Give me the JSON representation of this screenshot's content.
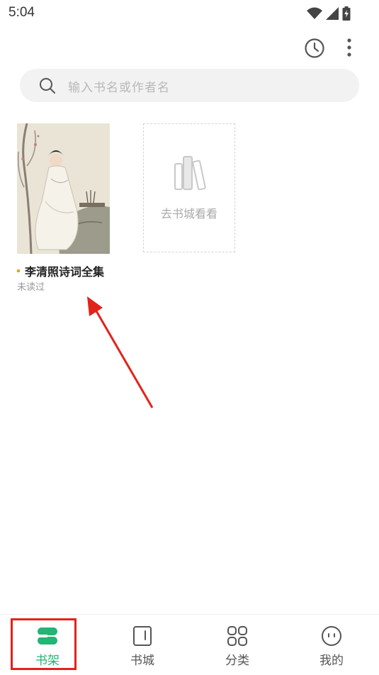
{
  "status_bar": {
    "time": "5:04"
  },
  "header": {
    "history_icon": "clock-icon",
    "more_icon": "more-vertical-icon"
  },
  "search": {
    "placeholder": "输入书名或作者名",
    "icon": "search-icon"
  },
  "bookshelf": {
    "books": [
      {
        "title": "李清照诗词全集",
        "status": "未读过"
      }
    ],
    "goto_store": {
      "label": "去书城看看",
      "icon": "books-icon"
    }
  },
  "bottom_nav": {
    "items": [
      {
        "label": "书架",
        "icon": "bookshelf-icon",
        "active": true
      },
      {
        "label": "书城",
        "icon": "book-icon",
        "active": false
      },
      {
        "label": "分类",
        "icon": "grid-icon",
        "active": false
      },
      {
        "label": "我的",
        "icon": "profile-face-icon",
        "active": false
      }
    ]
  },
  "colors": {
    "accent": "#22b573",
    "annotation": "#e2231a",
    "new_dot": "#f0a020"
  }
}
